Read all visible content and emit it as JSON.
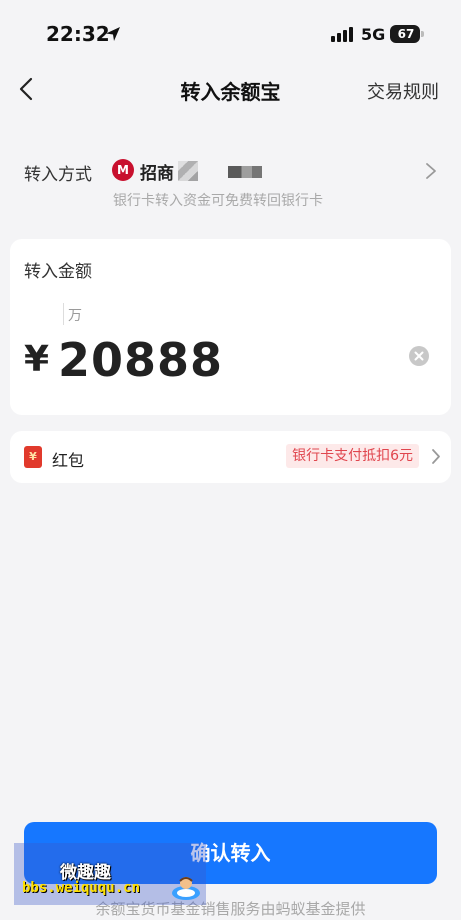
{
  "status_bar": {
    "time": "22:32",
    "network": "5G",
    "battery": "67"
  },
  "nav": {
    "title": "转入余额宝",
    "rules": "交易规则",
    "back_icon": "chevron-left-icon"
  },
  "method": {
    "label": "转入方式",
    "bank_name": "招商",
    "bank_logo_text": "M",
    "sub_note": "银行卡转入资金可免费转回银行卡",
    "chevron_icon": "chevron-right-icon"
  },
  "amount": {
    "title": "转入金额",
    "unit_hint": "万",
    "currency": "¥",
    "value": "20888",
    "clear_icon": "clear-circle-icon"
  },
  "red_packet": {
    "icon_text": "¥",
    "label": "红包",
    "badge": "银行卡支付抵扣6元",
    "chevron_icon": "chevron-right-icon"
  },
  "confirm": {
    "label": "确认转入"
  },
  "footer": {
    "note": "余额宝货币基金销售服务由蚂蚁基金提供"
  },
  "watermark": {
    "title": "微趣趣",
    "url": "bbs.weiququ.cn"
  },
  "colors": {
    "primary": "#1677ff",
    "accent_red": "#e0464e",
    "background": "#f4f4f6"
  }
}
